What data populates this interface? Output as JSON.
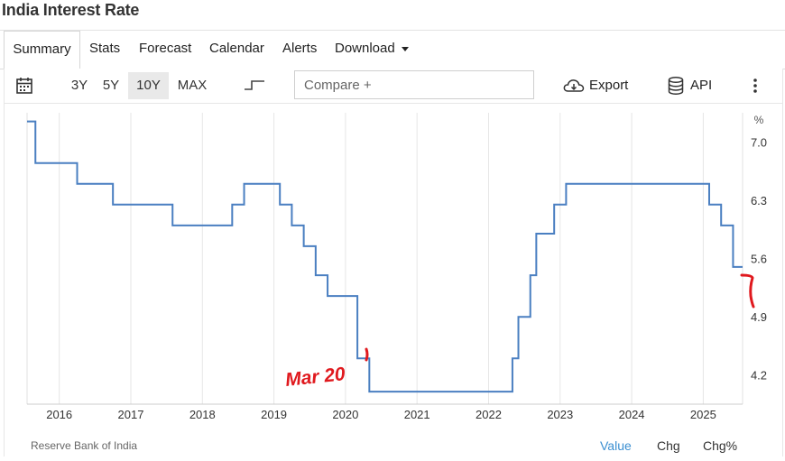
{
  "page": {
    "title": "India Interest Rate"
  },
  "tabs": [
    {
      "label": "Summary"
    },
    {
      "label": "Stats"
    },
    {
      "label": "Forecast"
    },
    {
      "label": "Calendar"
    },
    {
      "label": "Alerts"
    },
    {
      "label": "Download"
    }
  ],
  "toolbar": {
    "ranges": [
      "3Y",
      "5Y",
      "10Y",
      "MAX"
    ],
    "selected_range": "10Y",
    "compare_placeholder": "Compare +",
    "export_label": "Export",
    "api_label": "API",
    "icons": [
      "calendar-icon",
      "step-line-icon",
      "cloud-download-icon",
      "database-icon",
      "more-vertical-icon"
    ]
  },
  "footer": {
    "source": "Reserve Bank of India",
    "value_label": "Value",
    "chg_label": "Chg",
    "chgpct_label": "Chg%",
    "selected": "Value"
  },
  "annotation": {
    "text": "Mar 20",
    "color": "#e0191e"
  },
  "colors": {
    "line": "#4a7fc1",
    "accent": "#3b8fd1"
  },
  "chart_data": {
    "type": "line",
    "step": true,
    "unit_label": "%",
    "xlim": [
      2015.55,
      2025.55
    ],
    "ylim": [
      3.85,
      7.3
    ],
    "x_ticks": [
      2016,
      2017,
      2018,
      2019,
      2020,
      2021,
      2022,
      2023,
      2024,
      2025
    ],
    "x_tick_labels": [
      "2016",
      "2017",
      "2018",
      "2019",
      "2020",
      "2021",
      "2022",
      "2023",
      "2024",
      "2025"
    ],
    "y_ticks": [
      7.0,
      6.3,
      5.6,
      4.9,
      4.2
    ],
    "y_tick_labels": [
      "7.0",
      "6.3",
      "5.6",
      "4.9",
      "4.2"
    ],
    "grid": "vertical",
    "series": [
      {
        "values": [
          {
            "date": "2015-06",
            "rate": 7.25
          },
          {
            "date": "2015-09",
            "rate": 6.75
          },
          {
            "date": "2016-04",
            "rate": 6.5
          },
          {
            "date": "2016-10",
            "rate": 6.25
          },
          {
            "date": "2017-08",
            "rate": 6.0
          },
          {
            "date": "2018-06",
            "rate": 6.25
          },
          {
            "date": "2018-08",
            "rate": 6.5
          },
          {
            "date": "2019-02",
            "rate": 6.25
          },
          {
            "date": "2019-04",
            "rate": 6.0
          },
          {
            "date": "2019-06",
            "rate": 5.75
          },
          {
            "date": "2019-08",
            "rate": 5.4
          },
          {
            "date": "2019-10",
            "rate": 5.15
          },
          {
            "date": "2020-03",
            "rate": 4.4
          },
          {
            "date": "2020-05",
            "rate": 4.0
          },
          {
            "date": "2022-05",
            "rate": 4.4
          },
          {
            "date": "2022-06",
            "rate": 4.9
          },
          {
            "date": "2022-08",
            "rate": 5.4
          },
          {
            "date": "2022-09",
            "rate": 5.9
          },
          {
            "date": "2022-12",
            "rate": 6.25
          },
          {
            "date": "2023-02",
            "rate": 6.5
          },
          {
            "date": "2025-02",
            "rate": 6.25
          },
          {
            "date": "2025-04",
            "rate": 6.0
          },
          {
            "date": "2025-06",
            "rate": 5.5
          }
        ]
      }
    ]
  }
}
